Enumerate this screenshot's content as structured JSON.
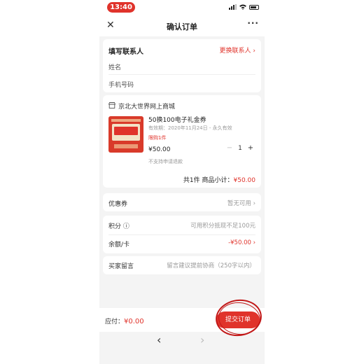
{
  "status_bar": {
    "time": "13:40"
  },
  "nav": {
    "close_icon": "close-icon",
    "title": "确认订单",
    "more": "···"
  },
  "contact": {
    "heading": "填写联系人",
    "change": "更换联系人 ›",
    "name_label": "姓名",
    "phone_label": "手机号码"
  },
  "shop": {
    "name": "京北大世界网上商城",
    "product": {
      "title": "50换100电子礼金券",
      "validity": "有效期：2020年11月24日 - 永久有效",
      "limit": "限购1件",
      "price": "¥50.00",
      "note": "不支持申请退款",
      "quantity": "1",
      "minus": "−",
      "plus": "+"
    },
    "subtotal_prefix": "共1件  商品小计：",
    "subtotal_value": "¥50.00"
  },
  "coupon": {
    "label": "优惠券",
    "value": "暂无可用 ›"
  },
  "points": {
    "label": "积分 ⓘ",
    "value": "可用积分抵现不足100元"
  },
  "balance": {
    "label": "余额/卡",
    "value": "-¥50.00 ›"
  },
  "message": {
    "label": "买家留言",
    "placeholder": "留言建议提前协商（250字以内）"
  },
  "footer": {
    "pay_label": "应付：",
    "pay_amount": "¥0.00",
    "submit": "提交订单"
  },
  "bottom_nav": {
    "back": "‹",
    "forward": "›"
  },
  "colors": {
    "accent": "#e0332b",
    "annotation": "#c21818",
    "background": "#f4f4f4"
  }
}
